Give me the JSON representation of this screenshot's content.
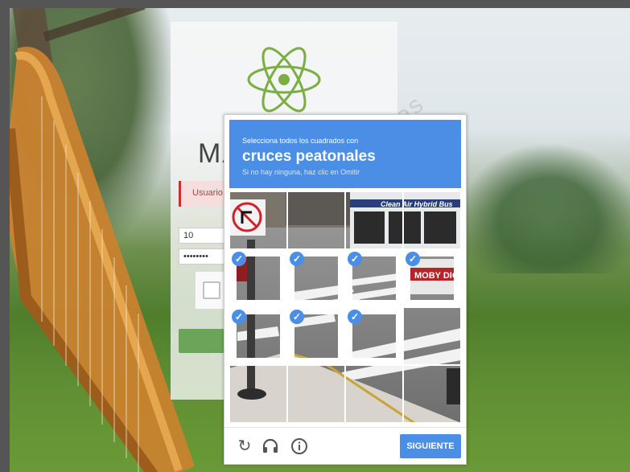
{
  "login": {
    "brand": "MA",
    "alert": "Usuario o",
    "user_value": "10",
    "password_value": "••••••••"
  },
  "watermark": "as",
  "captcha": {
    "instruction_line1": "Selecciona todos los cuadrados con",
    "target": "cruces peatonales",
    "hint": "Si no hay ninguna, haz clic en Omitir",
    "tiles": [
      {
        "selected": false
      },
      {
        "selected": false
      },
      {
        "selected": false
      },
      {
        "selected": false
      },
      {
        "selected": true
      },
      {
        "selected": true
      },
      {
        "selected": true
      },
      {
        "selected": true
      },
      {
        "selected": true
      },
      {
        "selected": true
      },
      {
        "selected": true
      },
      {
        "selected": false
      },
      {
        "selected": false
      },
      {
        "selected": false
      },
      {
        "selected": false
      },
      {
        "selected": false
      }
    ],
    "bus_text": "Clean Air Hybrid Bus",
    "bus_text2": "MOBY DIC",
    "footer": {
      "reload_icon": "reload-icon",
      "audio_icon": "headphones-icon",
      "info_icon": "info-icon",
      "next_label": "SIGUIENTE"
    }
  },
  "colors": {
    "accent": "#4a8ee6",
    "alert_bg": "#f7dede",
    "login_button": "#6aa55a"
  }
}
